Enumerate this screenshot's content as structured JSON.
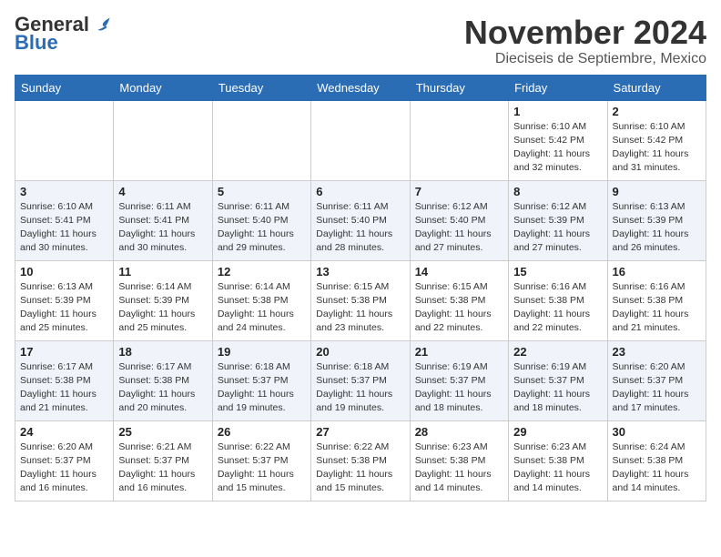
{
  "logo": {
    "general": "General",
    "blue": "Blue"
  },
  "header": {
    "month": "November 2024",
    "location": "Dieciseis de Septiembre, Mexico"
  },
  "days_of_week": [
    "Sunday",
    "Monday",
    "Tuesday",
    "Wednesday",
    "Thursday",
    "Friday",
    "Saturday"
  ],
  "weeks": [
    [
      {
        "day": "",
        "info": ""
      },
      {
        "day": "",
        "info": ""
      },
      {
        "day": "",
        "info": ""
      },
      {
        "day": "",
        "info": ""
      },
      {
        "day": "",
        "info": ""
      },
      {
        "day": "1",
        "info": "Sunrise: 6:10 AM\nSunset: 5:42 PM\nDaylight: 11 hours\nand 32 minutes."
      },
      {
        "day": "2",
        "info": "Sunrise: 6:10 AM\nSunset: 5:42 PM\nDaylight: 11 hours\nand 31 minutes."
      }
    ],
    [
      {
        "day": "3",
        "info": "Sunrise: 6:10 AM\nSunset: 5:41 PM\nDaylight: 11 hours\nand 30 minutes."
      },
      {
        "day": "4",
        "info": "Sunrise: 6:11 AM\nSunset: 5:41 PM\nDaylight: 11 hours\nand 30 minutes."
      },
      {
        "day": "5",
        "info": "Sunrise: 6:11 AM\nSunset: 5:40 PM\nDaylight: 11 hours\nand 29 minutes."
      },
      {
        "day": "6",
        "info": "Sunrise: 6:11 AM\nSunset: 5:40 PM\nDaylight: 11 hours\nand 28 minutes."
      },
      {
        "day": "7",
        "info": "Sunrise: 6:12 AM\nSunset: 5:40 PM\nDaylight: 11 hours\nand 27 minutes."
      },
      {
        "day": "8",
        "info": "Sunrise: 6:12 AM\nSunset: 5:39 PM\nDaylight: 11 hours\nand 27 minutes."
      },
      {
        "day": "9",
        "info": "Sunrise: 6:13 AM\nSunset: 5:39 PM\nDaylight: 11 hours\nand 26 minutes."
      }
    ],
    [
      {
        "day": "10",
        "info": "Sunrise: 6:13 AM\nSunset: 5:39 PM\nDaylight: 11 hours\nand 25 minutes."
      },
      {
        "day": "11",
        "info": "Sunrise: 6:14 AM\nSunset: 5:39 PM\nDaylight: 11 hours\nand 25 minutes."
      },
      {
        "day": "12",
        "info": "Sunrise: 6:14 AM\nSunset: 5:38 PM\nDaylight: 11 hours\nand 24 minutes."
      },
      {
        "day": "13",
        "info": "Sunrise: 6:15 AM\nSunset: 5:38 PM\nDaylight: 11 hours\nand 23 minutes."
      },
      {
        "day": "14",
        "info": "Sunrise: 6:15 AM\nSunset: 5:38 PM\nDaylight: 11 hours\nand 22 minutes."
      },
      {
        "day": "15",
        "info": "Sunrise: 6:16 AM\nSunset: 5:38 PM\nDaylight: 11 hours\nand 22 minutes."
      },
      {
        "day": "16",
        "info": "Sunrise: 6:16 AM\nSunset: 5:38 PM\nDaylight: 11 hours\nand 21 minutes."
      }
    ],
    [
      {
        "day": "17",
        "info": "Sunrise: 6:17 AM\nSunset: 5:38 PM\nDaylight: 11 hours\nand 21 minutes."
      },
      {
        "day": "18",
        "info": "Sunrise: 6:17 AM\nSunset: 5:38 PM\nDaylight: 11 hours\nand 20 minutes."
      },
      {
        "day": "19",
        "info": "Sunrise: 6:18 AM\nSunset: 5:37 PM\nDaylight: 11 hours\nand 19 minutes."
      },
      {
        "day": "20",
        "info": "Sunrise: 6:18 AM\nSunset: 5:37 PM\nDaylight: 11 hours\nand 19 minutes."
      },
      {
        "day": "21",
        "info": "Sunrise: 6:19 AM\nSunset: 5:37 PM\nDaylight: 11 hours\nand 18 minutes."
      },
      {
        "day": "22",
        "info": "Sunrise: 6:19 AM\nSunset: 5:37 PM\nDaylight: 11 hours\nand 18 minutes."
      },
      {
        "day": "23",
        "info": "Sunrise: 6:20 AM\nSunset: 5:37 PM\nDaylight: 11 hours\nand 17 minutes."
      }
    ],
    [
      {
        "day": "24",
        "info": "Sunrise: 6:20 AM\nSunset: 5:37 PM\nDaylight: 11 hours\nand 16 minutes."
      },
      {
        "day": "25",
        "info": "Sunrise: 6:21 AM\nSunset: 5:37 PM\nDaylight: 11 hours\nand 16 minutes."
      },
      {
        "day": "26",
        "info": "Sunrise: 6:22 AM\nSunset: 5:37 PM\nDaylight: 11 hours\nand 15 minutes."
      },
      {
        "day": "27",
        "info": "Sunrise: 6:22 AM\nSunset: 5:38 PM\nDaylight: 11 hours\nand 15 minutes."
      },
      {
        "day": "28",
        "info": "Sunrise: 6:23 AM\nSunset: 5:38 PM\nDaylight: 11 hours\nand 14 minutes."
      },
      {
        "day": "29",
        "info": "Sunrise: 6:23 AM\nSunset: 5:38 PM\nDaylight: 11 hours\nand 14 minutes."
      },
      {
        "day": "30",
        "info": "Sunrise: 6:24 AM\nSunset: 5:38 PM\nDaylight: 11 hours\nand 14 minutes."
      }
    ]
  ]
}
